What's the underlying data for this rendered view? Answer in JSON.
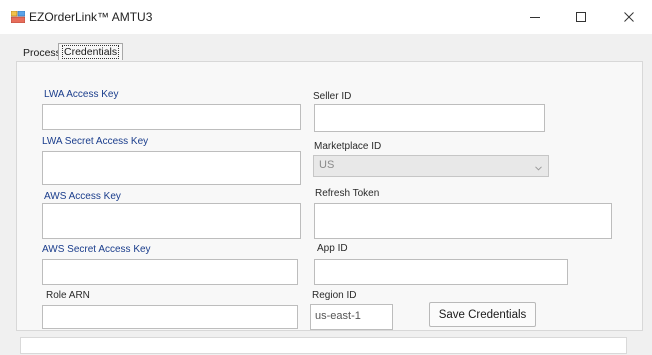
{
  "window": {
    "title": "EZOrderLink™ AMTU3",
    "icon": "app-window-icon",
    "controls": {
      "minimize": "minimize-icon",
      "maximize": "maximize-icon",
      "close": "close-icon"
    }
  },
  "tabs": [
    {
      "label": "Process",
      "active": false
    },
    {
      "label": "Credentials",
      "active": true
    }
  ],
  "credentials": {
    "lwa_access_key": {
      "label": "LWA Access Key",
      "value": ""
    },
    "lwa_secret_access_key": {
      "label": "LWA Secret Access Key",
      "value": ""
    },
    "aws_access_key": {
      "label": "AWS Access Key",
      "value": ""
    },
    "aws_secret_access_key": {
      "label": "AWS Secret Access Key",
      "value": ""
    },
    "role_arn": {
      "label": "Role ARN",
      "value": ""
    },
    "seller_id": {
      "label": "Seller ID",
      "value": ""
    },
    "marketplace_id": {
      "label": "Marketplace ID",
      "value": "US"
    },
    "refresh_token": {
      "label": "Refresh Token",
      "value": ""
    },
    "app_id": {
      "label": "App ID",
      "value": ""
    },
    "region_id": {
      "label": "Region ID",
      "value": "us-east-1"
    },
    "save_button": "Save Credentials"
  },
  "colors": {
    "label_blue": "#1a3d8c",
    "window_bg": "#f0f0f0",
    "panel_bg": "#f8f8f8"
  }
}
